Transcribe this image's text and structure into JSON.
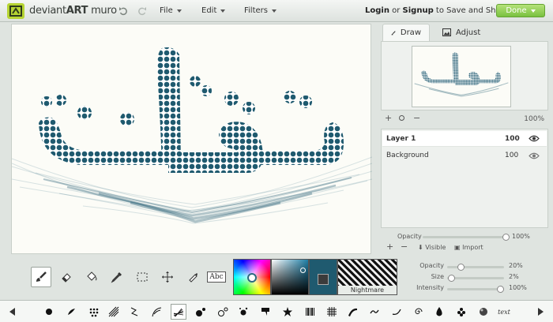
{
  "header": {
    "logo_word1": "deviant",
    "logo_word2": "ART",
    "logo_word3": " muro",
    "menus": {
      "file": "File",
      "edit": "Edit",
      "filters": "Filters"
    },
    "login": "Login",
    "or": " or ",
    "signup": "Signup",
    "save_share": " to Save and Share!",
    "done": "Done"
  },
  "panel": {
    "tab_draw": "Draw",
    "tab_adjust": "Adjust",
    "zoom": "100%",
    "layers": [
      {
        "name": "Layer 1",
        "opacity": "100"
      },
      {
        "name": "Background",
        "opacity": "100"
      }
    ],
    "opacity_label": "Opacity",
    "opacity_value": "100%",
    "visible_label": "Visible",
    "import_label": "Import"
  },
  "colors": {
    "nightmare_label": "Nightmare",
    "primary": "#ffffff",
    "secondary": "#1f5a6f",
    "accent": "#2d6a80",
    "done_green": "#79c13f"
  },
  "brush_settings": {
    "opacity_label": "Opacity",
    "opacity_value": "20%",
    "opacity_level": 0.2,
    "size_label": "Size",
    "size_value": "2%",
    "size_level": 0.02,
    "intensity_label": "Intensity",
    "intensity_value": "100%",
    "intensity_level": 1.0
  },
  "tools": {
    "text_tool_label": "Abc",
    "icons": [
      "brush-icon",
      "eraser-icon",
      "bucket-icon",
      "eyedropper-icon",
      "marquee-icon",
      "move-icon",
      "smudge-icon",
      "text-icon"
    ]
  },
  "brushes": {
    "text_brush_label": "text"
  }
}
